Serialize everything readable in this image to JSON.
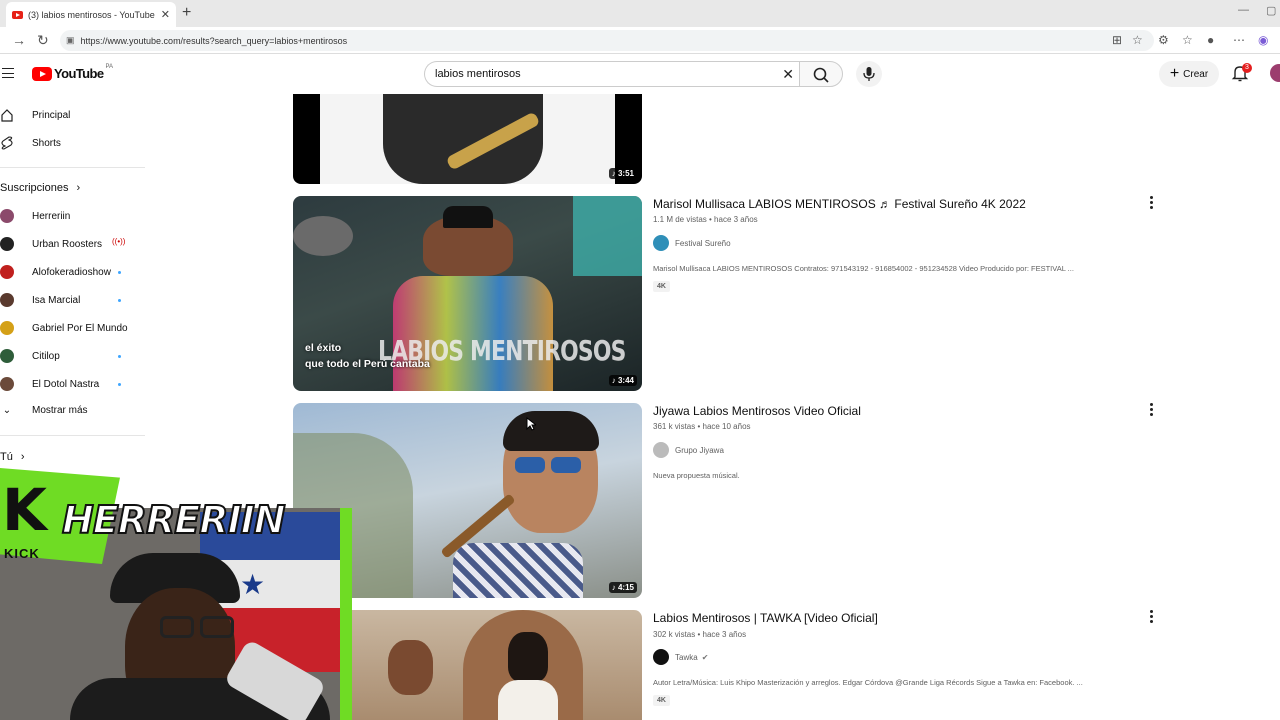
{
  "browser": {
    "tab_title": "(3) labios mentirosos - YouTube",
    "url": "https://www.youtube.com/results?search_query=labios+mentirosos"
  },
  "header": {
    "logo_text": "YouTube",
    "region": "PA",
    "search_value": "labios mentirosos",
    "create_label": "Crear",
    "notif_count": "3"
  },
  "sidebar": {
    "home": "Principal",
    "shorts": "Shorts",
    "subs_title": "Suscripciones",
    "subs": [
      {
        "name": "Herreriin",
        "color": "#8b4a6b"
      },
      {
        "name": "Urban Roosters",
        "color": "#222222"
      },
      {
        "name": "Alofokeradioshow",
        "color": "#c0201e"
      },
      {
        "name": "Isa Marcial",
        "color": "#5a3a2e"
      },
      {
        "name": "Gabriel Por El Mundo",
        "color": "#d4a017"
      },
      {
        "name": "Citilop",
        "color": "#2e5d3a"
      },
      {
        "name": "El Dotol Nastra",
        "color": "#6b4a3a"
      }
    ],
    "show_more": "Mostrar más",
    "you": "Tú"
  },
  "results": [
    {
      "duration": "3:51"
    },
    {
      "title": "Marisol Mullisaca LABIOS MENTIROSOS ♬ Festival Sureño 4K 2022",
      "meta": "1.1 M de vistas • hace 3 años",
      "channel": "Festival Sureño",
      "desc": "Marisol Mullisaca LABIOS MENTIROSOS Contratos: 971543192 - 916854002 - 951234528 Video Producido por: FESTIVAL ...",
      "badge": "4K",
      "duration": "3:44",
      "overlay_line1": "el éxito",
      "overlay_line2": "que todo el Perú cantaba",
      "overlay_big": "LABIOS MENTIROSOS"
    },
    {
      "title": "Jiyawa Labios Mentirosos Video Oficial",
      "meta": "361 k vistas • hace 10 años",
      "channel": "Grupo Jiyawa",
      "desc": "Nueva propuesta músical.",
      "duration": "4:15"
    },
    {
      "title": "Labios Mentirosos | TAWKA [Video Oficial]",
      "meta": "302 k vistas • hace 3 años",
      "channel": "Tawka",
      "desc": "Autor Letra/Música: Luis Khipo Masterización y arreglos. Edgar Córdova @Grande Liga Récords Sigue a Tawka en: Facebook. ...",
      "badge": "4K"
    }
  ],
  "stream_overlay": {
    "brand": "HERRERIIN",
    "platform": "KICK"
  }
}
